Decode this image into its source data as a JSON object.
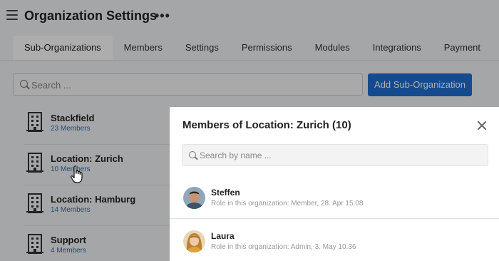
{
  "header": {
    "title": "Organization Settings",
    "more": "•••"
  },
  "tabs": [
    {
      "label": "Sub-Organizations",
      "active": true
    },
    {
      "label": "Members"
    },
    {
      "label": "Settings"
    },
    {
      "label": "Permissions"
    },
    {
      "label": "Modules"
    },
    {
      "label": "Integrations"
    },
    {
      "label": "Payment"
    }
  ],
  "search": {
    "placeholder": "Search ..."
  },
  "add_button": {
    "label": "Add Sub-Organization"
  },
  "organizations": [
    {
      "name": "Stackfield",
      "members": "23 Members"
    },
    {
      "name": "Location: Zurich",
      "members": "10 Members"
    },
    {
      "name": "Location: Hamburg",
      "members": "14 Members"
    },
    {
      "name": "Support",
      "members": "4 Members"
    }
  ],
  "modal": {
    "title": "Members of Location: Zurich (10)",
    "search_placeholder": "Search by name ...",
    "members": [
      {
        "name": "Steffen",
        "role": "Role in this organization: Member, 28. Apr 15:08"
      },
      {
        "name": "Laura",
        "role": "Role in this organization: Admin, 3. May 10:36"
      }
    ]
  },
  "colors": {
    "accent": "#1f6fd1",
    "link": "#2f6fb5",
    "overlay": "rgba(0,0,0,0.32)"
  }
}
